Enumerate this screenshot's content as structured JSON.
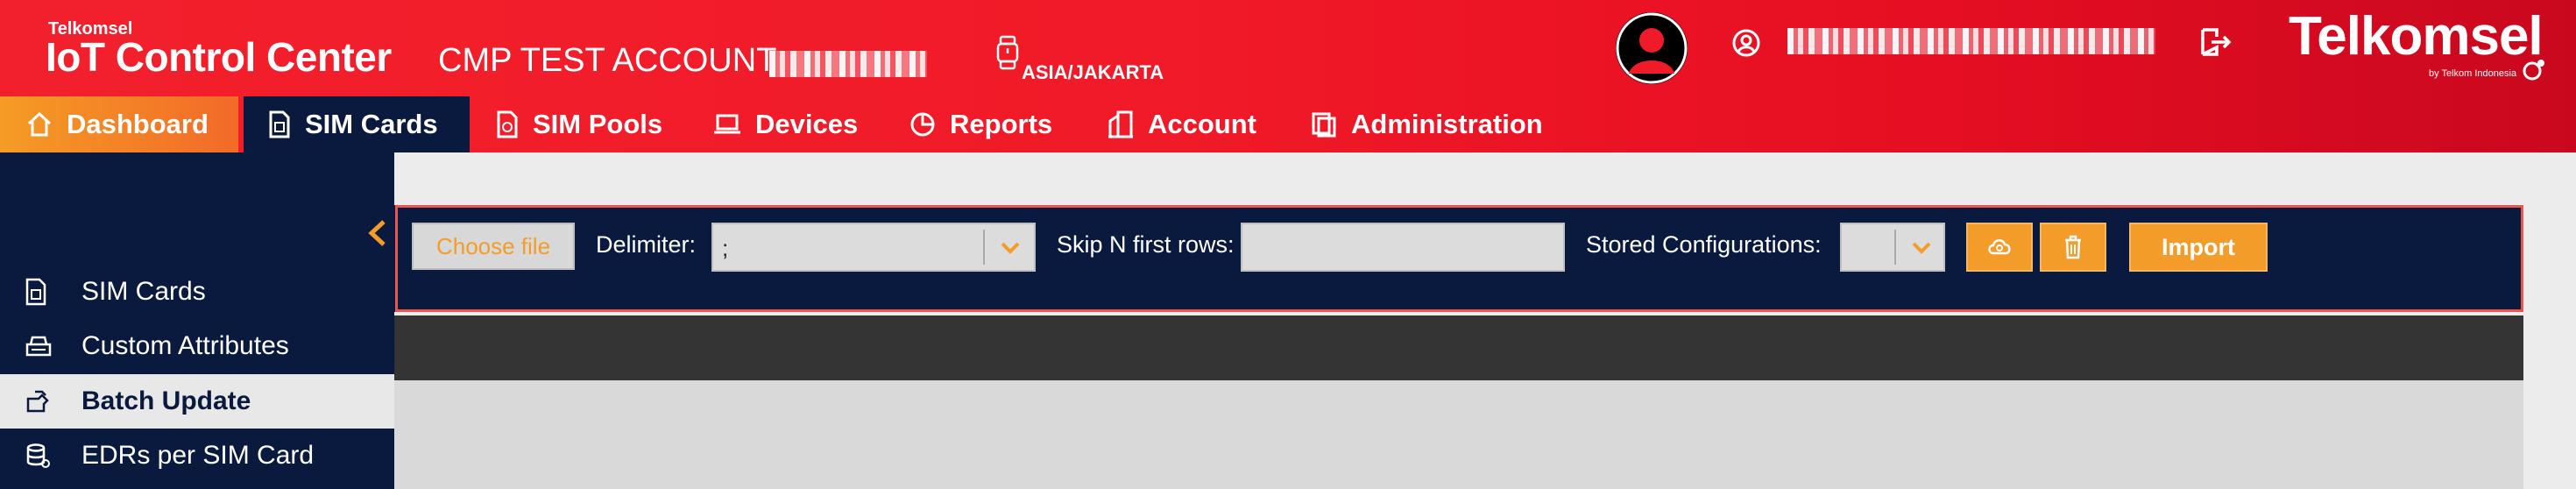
{
  "header": {
    "brand_small": "Telkomsel",
    "brand_title": "IoT Control Center",
    "account_name": "CMP TEST ACCOUNT",
    "timezone": "ASIA/JAKARTA",
    "logo": "Telkomsel",
    "logo_sub": "by Telkom Indonesia"
  },
  "nav": {
    "items": [
      {
        "label": "Dashboard",
        "icon": "home-icon"
      },
      {
        "label": "SIM Cards",
        "icon": "sim-card-icon"
      },
      {
        "label": "SIM Pools",
        "icon": "sim-pool-icon"
      },
      {
        "label": "Devices",
        "icon": "laptop-icon"
      },
      {
        "label": "Reports",
        "icon": "report-icon"
      },
      {
        "label": "Account",
        "icon": "building-icon"
      },
      {
        "label": "Administration",
        "icon": "admin-icon"
      }
    ],
    "active": "SIM Cards"
  },
  "sidebar": {
    "items": [
      {
        "label": "SIM Cards",
        "icon": "sim-card-icon"
      },
      {
        "label": "Custom Attributes",
        "icon": "attributes-icon"
      },
      {
        "label": "Batch Update",
        "icon": "batch-update-icon"
      },
      {
        "label": "EDRs per SIM Card",
        "icon": "database-icon"
      }
    ],
    "active": "Batch Update"
  },
  "toolbar": {
    "choose_file": "Choose file",
    "delimiter_label": "Delimiter:",
    "delimiter_value": ";",
    "skip_label": "Skip N first rows:",
    "skip_value": "",
    "stored_label": "Stored Configurations:",
    "stored_value": "",
    "import_label": "Import"
  },
  "colors": {
    "header_red": "#f2202c",
    "navy": "#0a1a3f",
    "accent_orange": "#f49c2a",
    "highlight_border": "#e9554f"
  }
}
